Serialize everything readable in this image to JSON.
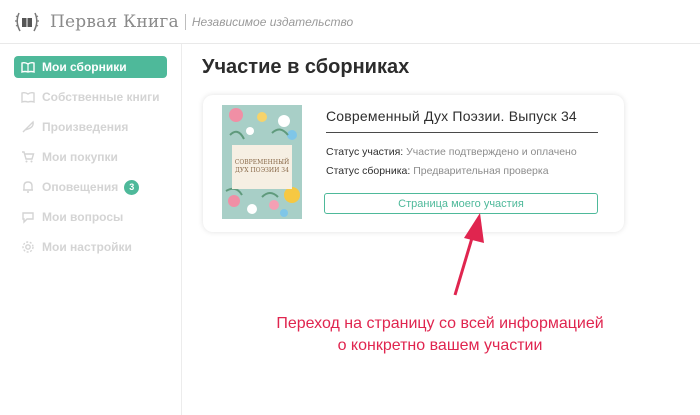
{
  "header": {
    "brand": "Первая Книга",
    "tagline": "Независимое издательство"
  },
  "sidebar": {
    "items": [
      {
        "label": "Мои сборники",
        "icon": "book-open-icon",
        "active": true
      },
      {
        "label": "Собственные книги",
        "icon": "book-icon",
        "active": false
      },
      {
        "label": "Произведения",
        "icon": "feather-icon",
        "active": false
      },
      {
        "label": "Мои покупки",
        "icon": "cart-icon",
        "active": false
      },
      {
        "label": "Оповещения",
        "icon": "bell-icon",
        "active": false,
        "badge": "3"
      },
      {
        "label": "Мои вопросы",
        "icon": "chat-icon",
        "active": false
      },
      {
        "label": "Мои настройки",
        "icon": "gear-icon",
        "active": false
      }
    ]
  },
  "main": {
    "title": "Участие в сборниках",
    "card": {
      "cover_text": "СОВРЕМЕННЫЙ ДУХ ПОЭЗИИ 34",
      "collection_title": "Современный Дух Поэзии. Выпуск 34",
      "participation_label": "Статус участия:",
      "participation_value": "Участие подтверждено и оплачено",
      "collection_status_label": "Статус сборника:",
      "collection_status_value": "Предварительная проверка",
      "button_label": "Страница моего участия"
    }
  },
  "annotation": {
    "line1": "Переход на страницу со всей информацией",
    "line2": "о конкретно вашем участии"
  },
  "colors": {
    "accent": "#4eb99a",
    "annotation": "#e0254f",
    "inactive_nav": "#d4d4d4"
  }
}
